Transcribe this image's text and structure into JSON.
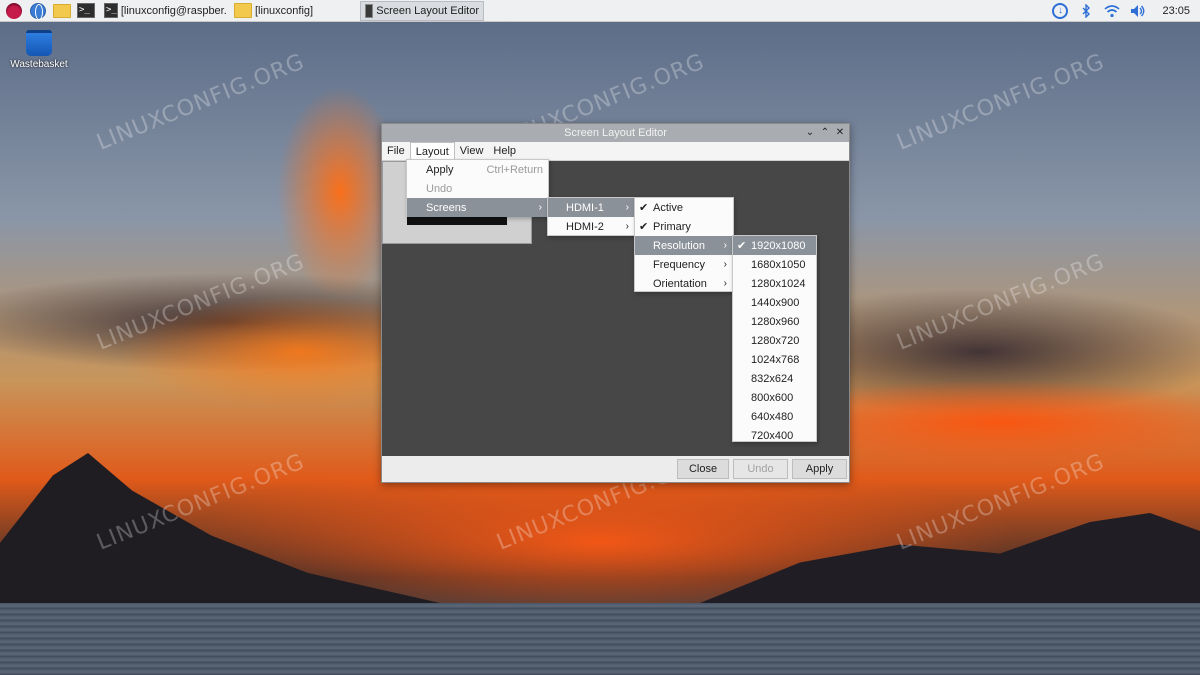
{
  "taskbar": {
    "launchers": [
      "raspberry-menu-icon",
      "web-browser-icon",
      "file-manager-icon",
      "terminal-icon"
    ],
    "tasks": [
      {
        "label": "[linuxconfig@raspber...",
        "icon": "terminal-icon"
      },
      {
        "label": "[linuxconfig]",
        "icon": "folder-icon"
      },
      {
        "label": "Screen Layout Editor",
        "icon": "monitor-icon",
        "active": true
      }
    ],
    "tray": {
      "icons": [
        "download-icon",
        "bluetooth-icon",
        "wifi-icon",
        "volume-icon"
      ],
      "clock": "23:05"
    }
  },
  "desktop": {
    "icons": [
      {
        "label": "Wastebasket"
      }
    ],
    "watermark": "LINUXCONFIG.ORG"
  },
  "window": {
    "title": "Screen Layout Editor",
    "controls": [
      "minimize",
      "maximize",
      "close"
    ],
    "menubar": [
      "File",
      "Layout",
      "View",
      "Help"
    ],
    "open_menu": "Layout",
    "buttons": {
      "close": "Close",
      "undo": "Undo",
      "apply": "Apply"
    }
  },
  "menus": {
    "layout": [
      {
        "label": "Apply",
        "accel": "Ctrl+Return"
      },
      {
        "label": "Undo",
        "disabled": true
      },
      {
        "label": "Screens",
        "submenu": true,
        "highlighted": true
      }
    ],
    "screens": [
      {
        "label": "HDMI-1",
        "submenu": true,
        "highlighted": true
      },
      {
        "label": "HDMI-2",
        "submenu": true
      }
    ],
    "hdmi1": [
      {
        "label": "Active",
        "checked": true
      },
      {
        "label": "Primary",
        "checked": true
      },
      {
        "label": "Resolution",
        "submenu": true,
        "highlighted": true
      },
      {
        "label": "Frequency",
        "submenu": true
      },
      {
        "label": "Orientation",
        "submenu": true
      }
    ],
    "resolution": {
      "selected": "1920x1080",
      "options": [
        "1920x1080",
        "1680x1050",
        "1280x1024",
        "1440x900",
        "1280x960",
        "1280x720",
        "1024x768",
        "832x624",
        "800x600",
        "640x480",
        "720x400"
      ]
    }
  }
}
